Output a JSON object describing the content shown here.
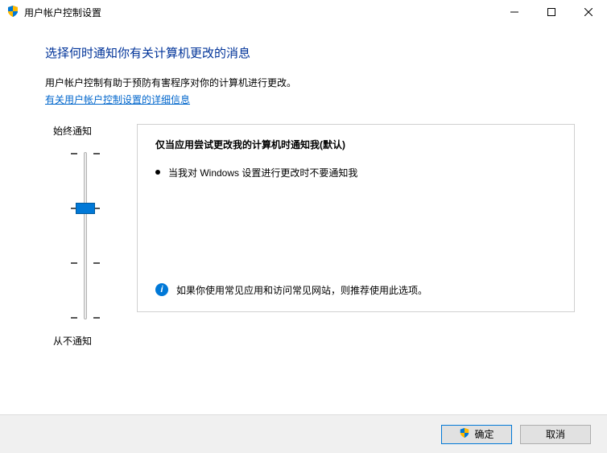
{
  "window": {
    "title": "用户帐户控制设置"
  },
  "heading": "选择何时通知你有关计算机更改的消息",
  "subtext": "用户帐户控制有助于预防有害程序对你的计算机进行更改。",
  "link_text": "有关用户帐户控制设置的详细信息",
  "slider": {
    "top_label": "始终通知",
    "bottom_label": "从不通知"
  },
  "panel": {
    "title": "仅当应用尝试更改我的计算机时通知我(默认)",
    "bullet": "当我对 Windows 设置进行更改时不要通知我",
    "footer": "如果你使用常见应用和访问常见网站，则推荐使用此选项。"
  },
  "buttons": {
    "ok": "确定",
    "cancel": "取消"
  }
}
